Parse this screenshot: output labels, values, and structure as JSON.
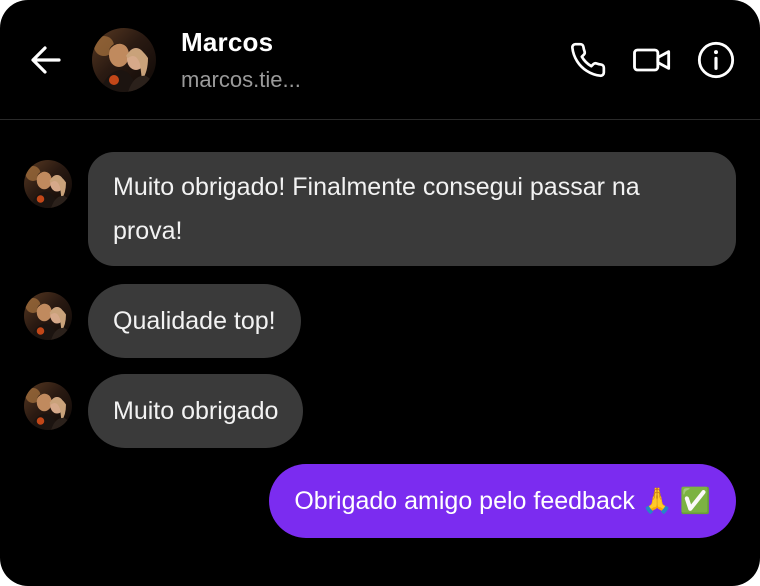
{
  "header": {
    "back_icon": "arrow-left-icon",
    "name": "Marcos",
    "handle": "marcos.tie...",
    "call_icon": "phone-icon",
    "video_icon": "video-camera-icon",
    "info_icon": "info-icon"
  },
  "messages": [
    {
      "direction": "incoming",
      "text": "Muito obrigado! Finalmente consegui passar na prova!"
    },
    {
      "direction": "incoming",
      "text": "Qualidade top!"
    },
    {
      "direction": "incoming",
      "text": "Muito obrigado"
    },
    {
      "direction": "outgoing",
      "text": "Obrigado amigo pelo feedback 🙏 ✅"
    }
  ],
  "colors": {
    "background": "#000000",
    "incoming_bubble": "#3a3a3a",
    "outgoing_bubble": "#7b2cf0",
    "secondary_text": "#9a9a9a"
  }
}
